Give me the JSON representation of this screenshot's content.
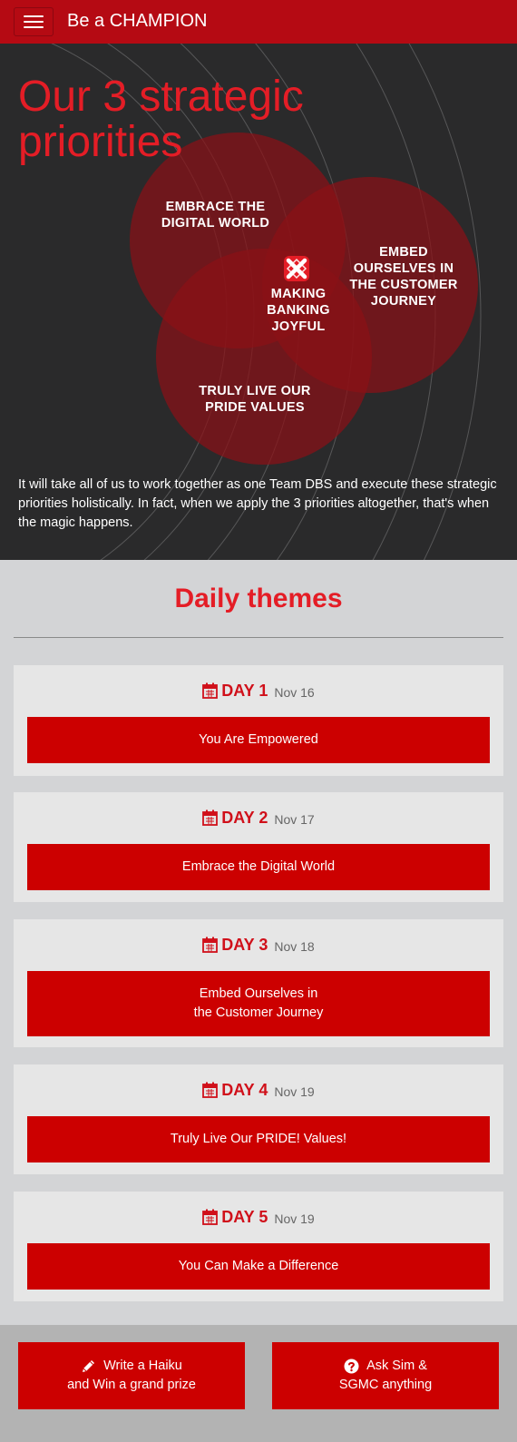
{
  "header": {
    "brand": "Be a CHAMPION",
    "menu_icon": "hamburger-menu-icon"
  },
  "hero": {
    "title": "Our 3 strategic priorities",
    "circles": {
      "digital": "EMBRACE THE\nDIGITAL WORLD",
      "customer": "EMBED\nOURSELVES IN\nTHE CUSTOMER\nJOURNEY",
      "center": "MAKING\nBANKING\nJOYFUL",
      "pride": "TRULY LIVE OUR\nPRIDE VALUES"
    },
    "logo_icon": "dbs-logo-icon",
    "text": "It will take all of us to work together as one Team DBS and execute these strategic priorities holistically. In fact, when we apply the 3 priorities altogether, that's when the magic happens."
  },
  "themes": {
    "title": "Daily themes",
    "days": [
      {
        "day": "DAY 1",
        "date": "Nov 16",
        "label": "You Are Empowered"
      },
      {
        "day": "DAY 2",
        "date": "Nov 17",
        "label": "Embrace the Digital World"
      },
      {
        "day": "DAY 3",
        "date": "Nov 18",
        "label": "Embed Ourselves in\nthe Customer Journey"
      },
      {
        "day": "DAY 4",
        "date": "Nov 19",
        "label": "Truly Live Our PRIDE! Values!"
      },
      {
        "day": "DAY 5",
        "date": "Nov 19",
        "label": "You Can Make a Difference"
      }
    ]
  },
  "footer": {
    "haiku_line1": "Write a Haiku",
    "haiku_line2": "and Win a grand prize",
    "ask_line1": "Ask Sim &",
    "ask_line2": "SGMC anything"
  },
  "colors": {
    "header_red": "#b50a13",
    "accent_red": "#e41d26",
    "button_red": "#cc0000",
    "hero_bg": "#2a2a2b",
    "themes_bg": "#d3d4d6",
    "card_bg": "#e6e6e6"
  }
}
